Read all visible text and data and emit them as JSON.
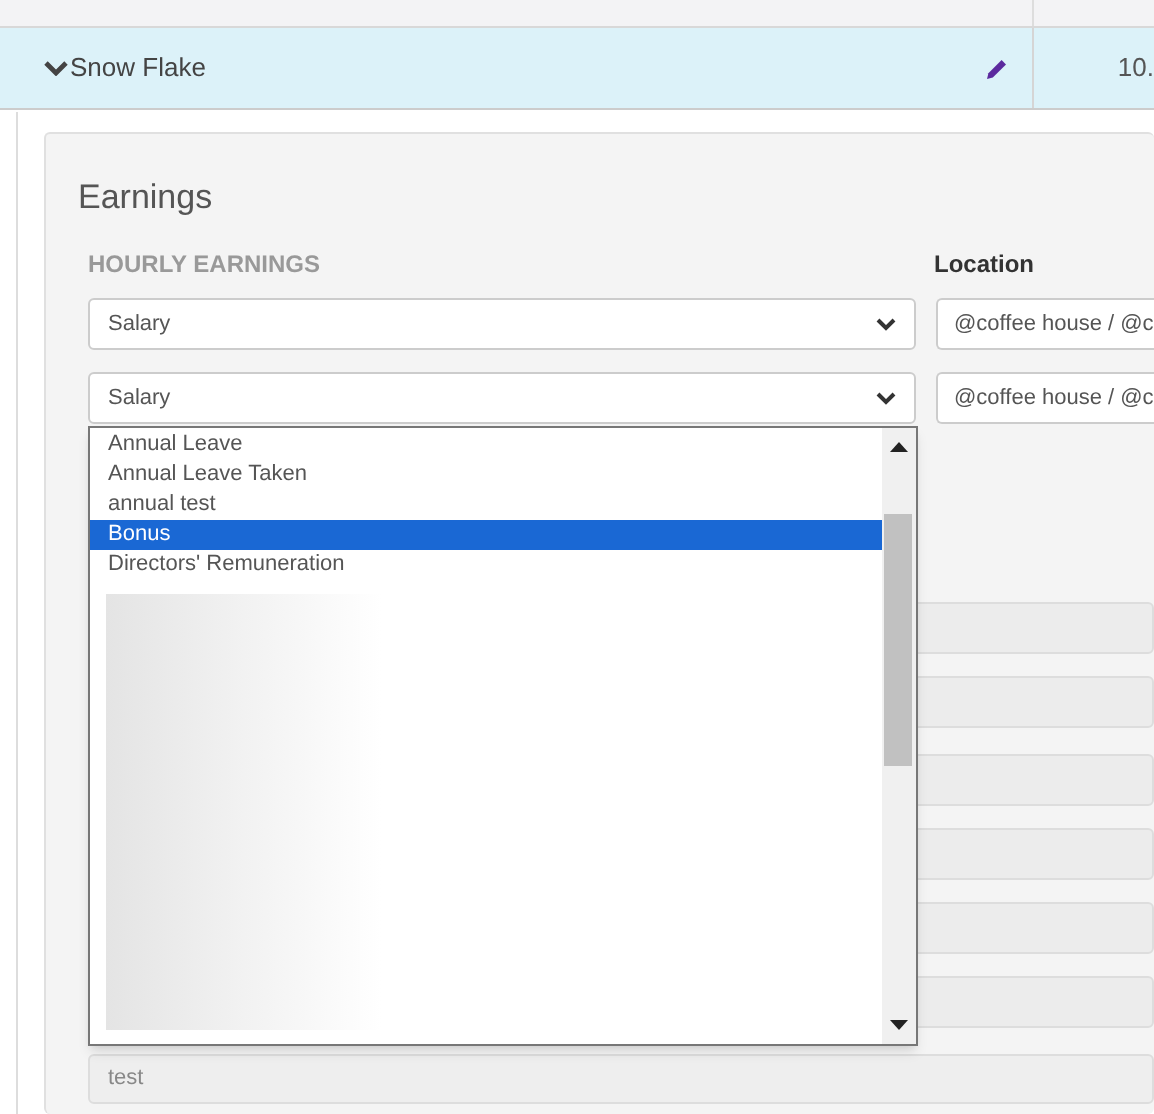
{
  "employee_row": {
    "name": "Snow Flake",
    "expanded": true,
    "amount": "10."
  },
  "earnings": {
    "title": "Earnings",
    "column_headers": [
      "HOURLY EARNINGS",
      "Location"
    ],
    "rows": [
      {
        "earning": "Salary",
        "location": "@coffee house / @c"
      },
      {
        "earning": "Salary",
        "location": "@coffee house / @c"
      }
    ],
    "dropdown": {
      "options": [
        {
          "label": "Annual Leave",
          "selected": false
        },
        {
          "label": "Annual Leave Taken",
          "selected": false
        },
        {
          "label": "annual test",
          "selected": false
        },
        {
          "label": "Bonus",
          "selected": true
        },
        {
          "label": "Directors' Remuneration",
          "selected": false
        }
      ]
    },
    "note_field": {
      "value": "test"
    }
  }
}
